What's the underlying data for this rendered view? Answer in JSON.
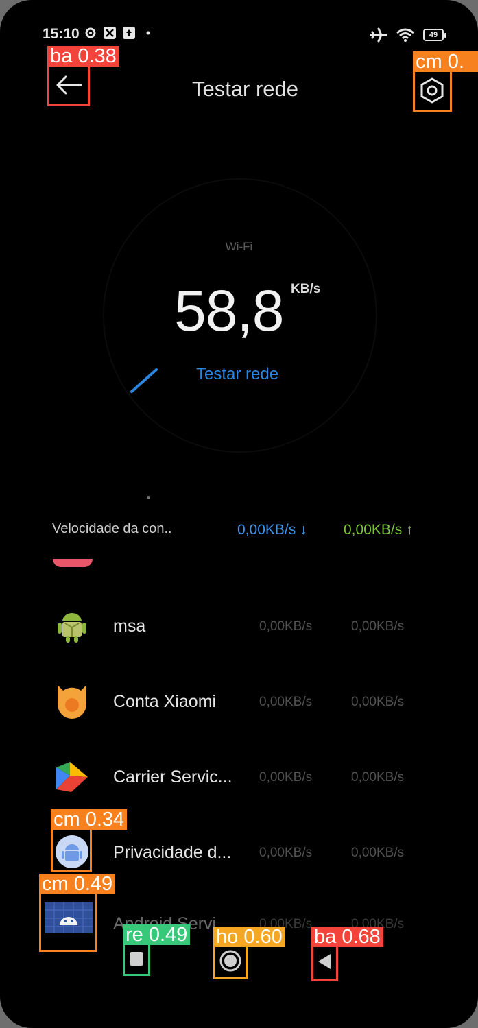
{
  "status_bar": {
    "time": "15:10",
    "battery": "49"
  },
  "header": {
    "title": "Testar rede"
  },
  "speed_test": {
    "network_type": "Wi-Fi",
    "speed_value": "58,8",
    "speed_unit": "KB/s",
    "test_button_label": "Testar rede"
  },
  "summary": {
    "label": "Velocidade da con..",
    "download": "0,00KB/s",
    "upload": "0,00KB/s"
  },
  "apps": [
    {
      "name": "msa",
      "download": "0,00KB/s",
      "upload": "0,00KB/s",
      "icon": "android-robot-icon"
    },
    {
      "name": "Conta Xiaomi",
      "download": "0,00KB/s",
      "upload": "0,00KB/s",
      "icon": "xiaomi-account-icon"
    },
    {
      "name": "Carrier Servic...",
      "download": "0,00KB/s",
      "upload": "0,00KB/s",
      "icon": "play-services-icon"
    },
    {
      "name": "Privacidade d...",
      "download": "0,00KB/s",
      "upload": "0,00KB/s",
      "icon": "privacy-android-icon"
    },
    {
      "name": "Android Servi",
      "download": "0,00KB/s",
      "upload": "0,00KB/s",
      "icon": "android-services-icon"
    }
  ],
  "detections": [
    {
      "label": "ba 0.38",
      "color": "#f2443a"
    },
    {
      "label": "cm 0.",
      "color": "#f7801f"
    },
    {
      "label": "cm 0.34",
      "color": "#f7801f"
    },
    {
      "label": "cm 0.49",
      "color": "#f7801f"
    },
    {
      "label": "re 0.49",
      "color": "#37c879"
    },
    {
      "label": "ho 0.60",
      "color": "#f5a623"
    },
    {
      "label": "ba 0.68",
      "color": "#f2443a"
    }
  ],
  "colors": {
    "accent_blue": "#2b86e0",
    "upload_green": "#7cc63a",
    "download_blue": "#3f95f0"
  }
}
